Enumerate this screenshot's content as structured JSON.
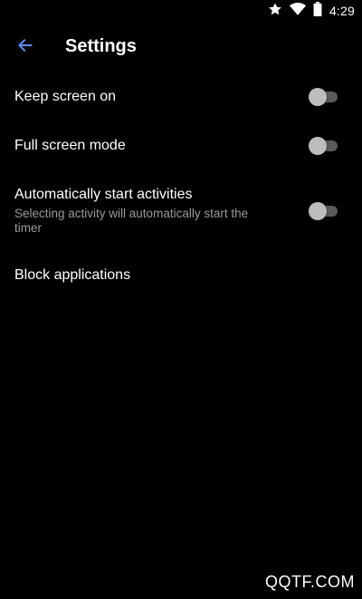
{
  "status_bar": {
    "time": "4:29",
    "icons": [
      "star-icon",
      "wifi-icon",
      "battery-icon"
    ]
  },
  "toolbar": {
    "back_icon": "arrow-back-icon",
    "title": "Settings"
  },
  "settings": [
    {
      "title": "Keep screen on",
      "summary": "",
      "enabled": false
    },
    {
      "title": "Full screen mode",
      "summary": "",
      "enabled": false
    },
    {
      "title": "Automatically start activities",
      "summary": "Selecting activity will automatically start the timer",
      "enabled": false
    },
    {
      "title": "Block applications",
      "summary": ""
    }
  ],
  "watermark": "QQTF.COM",
  "colors": {
    "background": "#000000",
    "accent": "#5b8def",
    "text_primary": "#ffffff",
    "text_secondary": "#9a9a9a",
    "switch_track_off": "#5a5a5a",
    "switch_thumb_off": "#bdbdbd"
  }
}
